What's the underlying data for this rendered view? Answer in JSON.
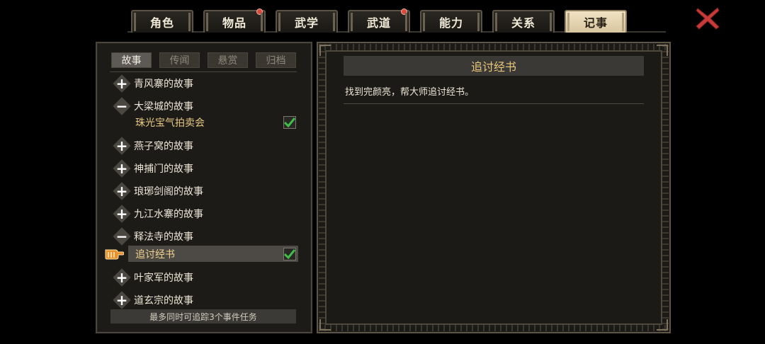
{
  "tabs": [
    {
      "label": "角色",
      "badge": false,
      "active": false
    },
    {
      "label": "物品",
      "badge": true,
      "active": false
    },
    {
      "label": "武学",
      "badge": false,
      "active": false
    },
    {
      "label": "武道",
      "badge": true,
      "active": false
    },
    {
      "label": "能力",
      "badge": false,
      "active": false
    },
    {
      "label": "关系",
      "badge": false,
      "active": false
    },
    {
      "label": "记事",
      "badge": false,
      "active": true
    }
  ],
  "subtabs": [
    {
      "label": "故事",
      "active": true
    },
    {
      "label": "传闻",
      "active": false
    },
    {
      "label": "悬赏",
      "active": false
    },
    {
      "label": "归档",
      "active": false
    }
  ],
  "stories": [
    {
      "title": "青风寨的故事",
      "expanded": false
    },
    {
      "title": "大梁城的故事",
      "expanded": true,
      "quests": [
        {
          "title": "珠光宝气拍卖会",
          "tracked": true
        }
      ]
    },
    {
      "title": "燕子窝的故事",
      "expanded": false
    },
    {
      "title": "神捕门的故事",
      "expanded": false
    },
    {
      "title": "琅琊剑阁的故事",
      "expanded": false
    },
    {
      "title": "九江水寨的故事",
      "expanded": false
    },
    {
      "title": "释法寺的故事",
      "expanded": true,
      "quests": [
        {
          "title": "追讨经书",
          "tracked": true,
          "selected": true
        }
      ]
    },
    {
      "title": "叶家军的故事",
      "expanded": false
    },
    {
      "title": "道玄宗的故事",
      "expanded": false
    }
  ],
  "footer_text": "最多同时可追踪3个事件任务",
  "detail": {
    "title": "追讨经书",
    "description": "找到完颜亮，帮大师追讨经书。"
  },
  "colors": {
    "accent_gold": "#e9c77b",
    "badge_red": "#d94a3e",
    "check_green": "#3fbf4a",
    "close_red": "#c93a3a"
  }
}
